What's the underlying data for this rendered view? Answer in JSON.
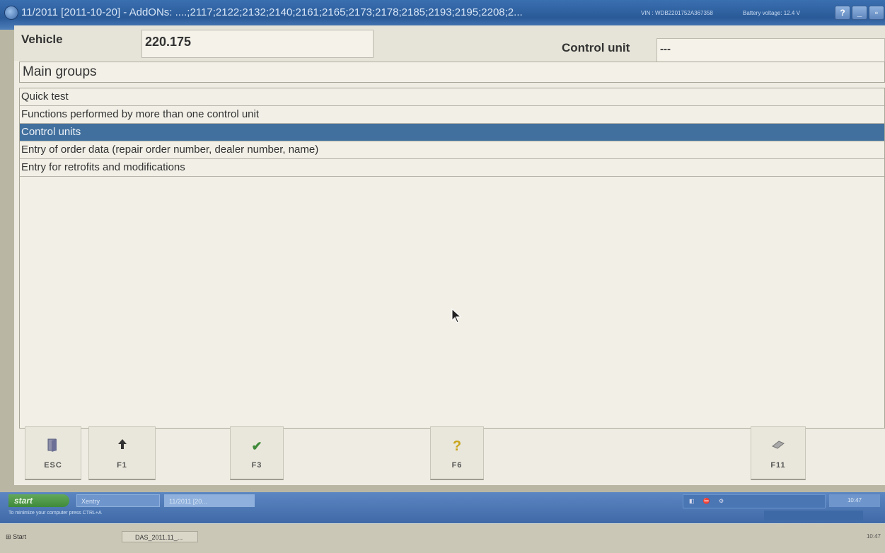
{
  "window": {
    "title": "11/2011 [2011-10-20] - AddONs: ....;2117;2122;2132;2140;2161;2165;2173;2178;2185;2193;2195;2208;2...",
    "vin_text": "VIN : WDB2201752A367358",
    "battery_text": "Battery voltage: 12.4 V"
  },
  "header": {
    "vehicle_label": "Vehicle",
    "vehicle_value": "220.175",
    "control_unit_label": "Control unit",
    "control_unit_value": "---"
  },
  "main_groups": {
    "title": "Main groups",
    "items": [
      {
        "label": "Quick test",
        "selected": false
      },
      {
        "label": "Functions performed by more than one control unit",
        "selected": false
      },
      {
        "label": "Control units",
        "selected": true
      },
      {
        "label": "Entry of order data (repair order number, dealer number, name)",
        "selected": false
      },
      {
        "label": "Entry for retrofits and modifications",
        "selected": false
      }
    ]
  },
  "function_keys": [
    {
      "key": "ESC",
      "icon": "exit-door-icon"
    },
    {
      "key": "F1",
      "icon": "arrow-up-icon"
    },
    {
      "key": "F3",
      "icon": "checkmark-icon"
    },
    {
      "key": "F6",
      "icon": "help-icon"
    },
    {
      "key": "F11",
      "icon": "eraser-icon"
    }
  ],
  "taskbar_top": {
    "start_label": "start",
    "item1": "Xentry",
    "item2": "11/2011 [20...",
    "hint": "To minimize your computer press CTRL+A",
    "clock": "10:47"
  },
  "taskbar_bottom": {
    "start_label": "Start",
    "item": "DAS_2011.11_...",
    "clock": "10:47"
  },
  "colors": {
    "titlebar": "#2a5a98",
    "selection": "#41709e",
    "background": "#efede3"
  }
}
